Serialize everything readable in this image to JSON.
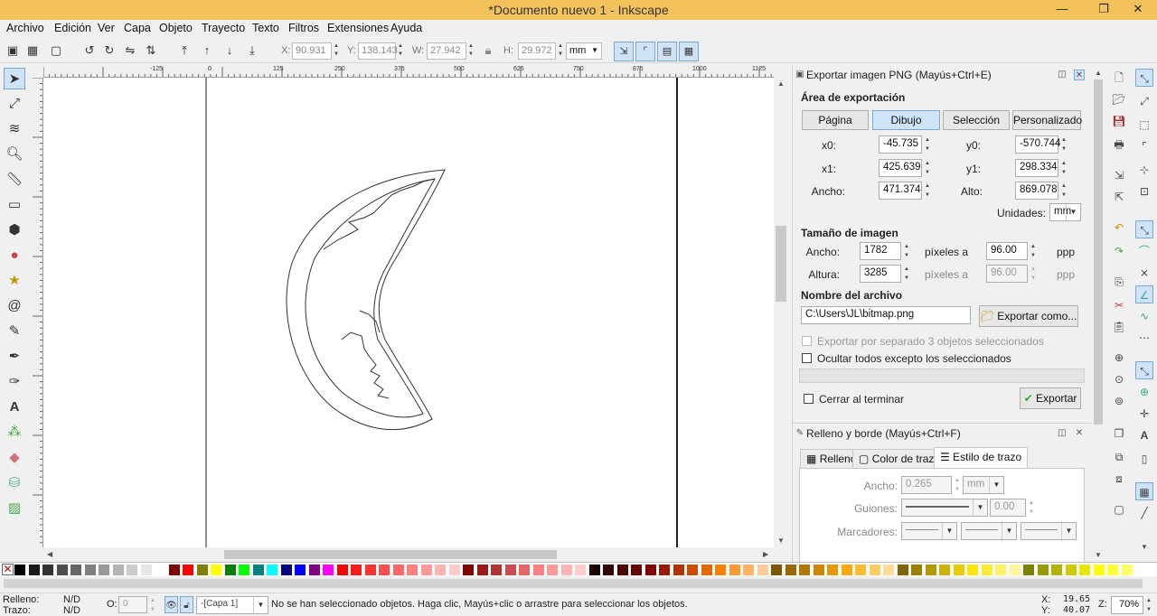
{
  "window": {
    "title": "*Documento nuevo 1 - Inkscape"
  },
  "menu": [
    "Archivo",
    "Edición",
    "Ver",
    "Capa",
    "Objeto",
    "Trayecto",
    "Texto",
    "Filtros",
    "Extensiones",
    "Ayuda"
  ],
  "toolctrl": {
    "x_label": "X:",
    "x_value": "90.931",
    "y_label": "Y:",
    "y_value": "138.143",
    "w_label": "W:",
    "w_value": "27.942",
    "h_label": "H:",
    "h_value": "29.972",
    "unit": "mm"
  },
  "ruler_top": [
    "-125",
    "0",
    "125",
    "250",
    "375",
    "500",
    "625",
    "750",
    "875",
    "1000",
    "1125"
  ],
  "ruler_left": [
    "0",
    "250",
    "500",
    "750"
  ],
  "export": {
    "title": "Exportar imagen PNG (Mayús+Ctrl+E)",
    "area_heading": "Área de exportación",
    "area_buttons": [
      "Página",
      "Dibujo",
      "Selección",
      "Personalizado"
    ],
    "x0_label": "x0:",
    "x0": "-45.735",
    "y0_label": "y0:",
    "y0": "-570.744",
    "x1_label": "x1:",
    "x1": "425.639",
    "y1_label": "y1:",
    "y1": "298.334",
    "width_label": "Ancho:",
    "width": "471.374",
    "height_label": "Alto:",
    "height": "869.078",
    "units_label": "Unidades:",
    "units": "mm",
    "size_heading": "Tamaño de imagen",
    "img_width_label": "Ancho:",
    "img_width": "1782",
    "img_height_label": "Altura:",
    "img_height": "3285",
    "dpi_label": "píxeles a",
    "dpi": "96.00",
    "dpi2": "96.00",
    "ppp": "ppp",
    "filename_heading": "Nombre del archivo",
    "filename": "C:\\Users\\JL\\bitmap.png",
    "export_as": "Exportar como...",
    "batch_label": "Exportar por separado 3 objetos seleccionados",
    "hide_label": "Ocultar todos excepto los seleccionados",
    "close_label": "Cerrar al terminar",
    "export_button": "Exportar"
  },
  "fill": {
    "title": "Relleno y borde (Mayús+Ctrl+F)",
    "tabs": [
      "Relleno",
      "Color de trazo",
      "Estilo de trazo"
    ],
    "width_label": "Ancho:",
    "width_value": "0.265",
    "width_unit": "mm",
    "dashes_label": "Guiones:",
    "dashes_value": "0.00",
    "markers_label": "Marcadores:"
  },
  "palette": [
    "#000000",
    "#1a1a1a",
    "#333333",
    "#4d4d4d",
    "#666666",
    "#808080",
    "#999999",
    "#b3b3b3",
    "#cccccc",
    "#e6e6e6",
    "#ffffff",
    "#800000",
    "#ff0000",
    "#808000",
    "#ffff00",
    "#008000",
    "#00ff00",
    "#008080",
    "#00ffff",
    "#000080",
    "#0000ff",
    "#800080",
    "#ff00ff",
    "#ff0000",
    "#ff1a1a",
    "#ff3333",
    "#ff4d4d",
    "#ff6666",
    "#ff8080",
    "#ff9999",
    "#ffb3b3",
    "#ffcccc",
    "#800000",
    "#991a1a",
    "#b33333",
    "#cc4d4d",
    "#e66666",
    "#ff8080",
    "#ff9999",
    "#ffb3b3",
    "#ffcccc",
    "#1a0000",
    "#330000",
    "#4d0000",
    "#660000",
    "#800000",
    "#991a00",
    "#b33300",
    "#cc4d00",
    "#e66600",
    "#ff8000",
    "#ff9933",
    "#ffb366",
    "#ffcc99",
    "#805500",
    "#996600",
    "#b37700",
    "#cc8800",
    "#e69900",
    "#ffaa00",
    "#ffbb33",
    "#ffcc66",
    "#ffdd99",
    "#806600",
    "#998000",
    "#b39900",
    "#ccb300",
    "#e6cc00",
    "#ffe600",
    "#ffeb33",
    "#fff066",
    "#fff599",
    "#808000",
    "#999900",
    "#b3b300",
    "#cccc00",
    "#e6e600",
    "#ffff00",
    "#ffff33",
    "#ffff66"
  ],
  "status": {
    "fill_label": "Relleno:",
    "fill_value": "N/D",
    "stroke_label": "Trazo:",
    "stroke_value": "N/D",
    "opacity_label": "O:",
    "opacity_value": "0",
    "layer": "-[Capa 1]",
    "message": "No se han seleccionado objetos. Haga clic, Mayús+clic o arrastre para seleccionar los objetos.",
    "x_label": "X:",
    "x": "19.65",
    "y_label": "Y:",
    "y": "40.07",
    "zoom_label": "Z:",
    "zoom": "70%"
  }
}
